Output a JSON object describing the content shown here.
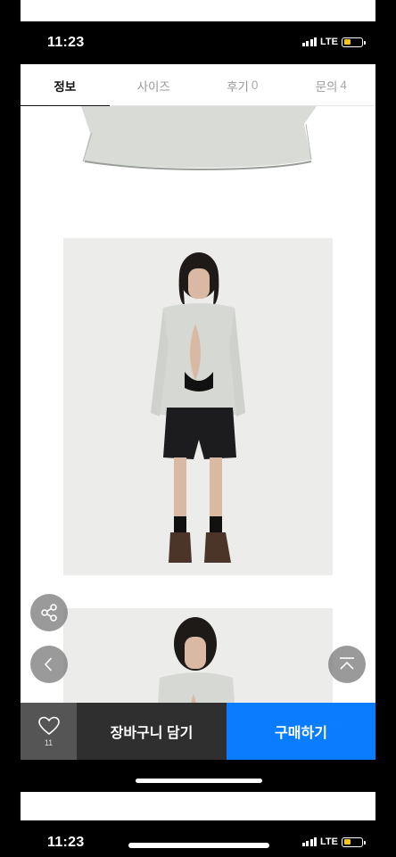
{
  "status_bar": {
    "time": "11:23",
    "network": "LTE"
  },
  "tabs": [
    {
      "label": "정보",
      "count": ""
    },
    {
      "label": "사이즈",
      "count": ""
    },
    {
      "label": "후기",
      "count": "0"
    },
    {
      "label": "문의",
      "count": "4"
    }
  ],
  "actions": {
    "like_count": "11",
    "cart_label": "장바구니 담기",
    "buy_label": "구매하기"
  },
  "icons": {
    "share": "share-icon",
    "back": "chevron-left-icon",
    "top": "scroll-top-icon",
    "like": "heart-icon"
  },
  "colors": {
    "buy": "#0a7cff",
    "cart": "#2f2f2f",
    "battery": "#f5c518"
  },
  "status_bar_repeat": {
    "time": "11:23",
    "network": "LTE"
  }
}
